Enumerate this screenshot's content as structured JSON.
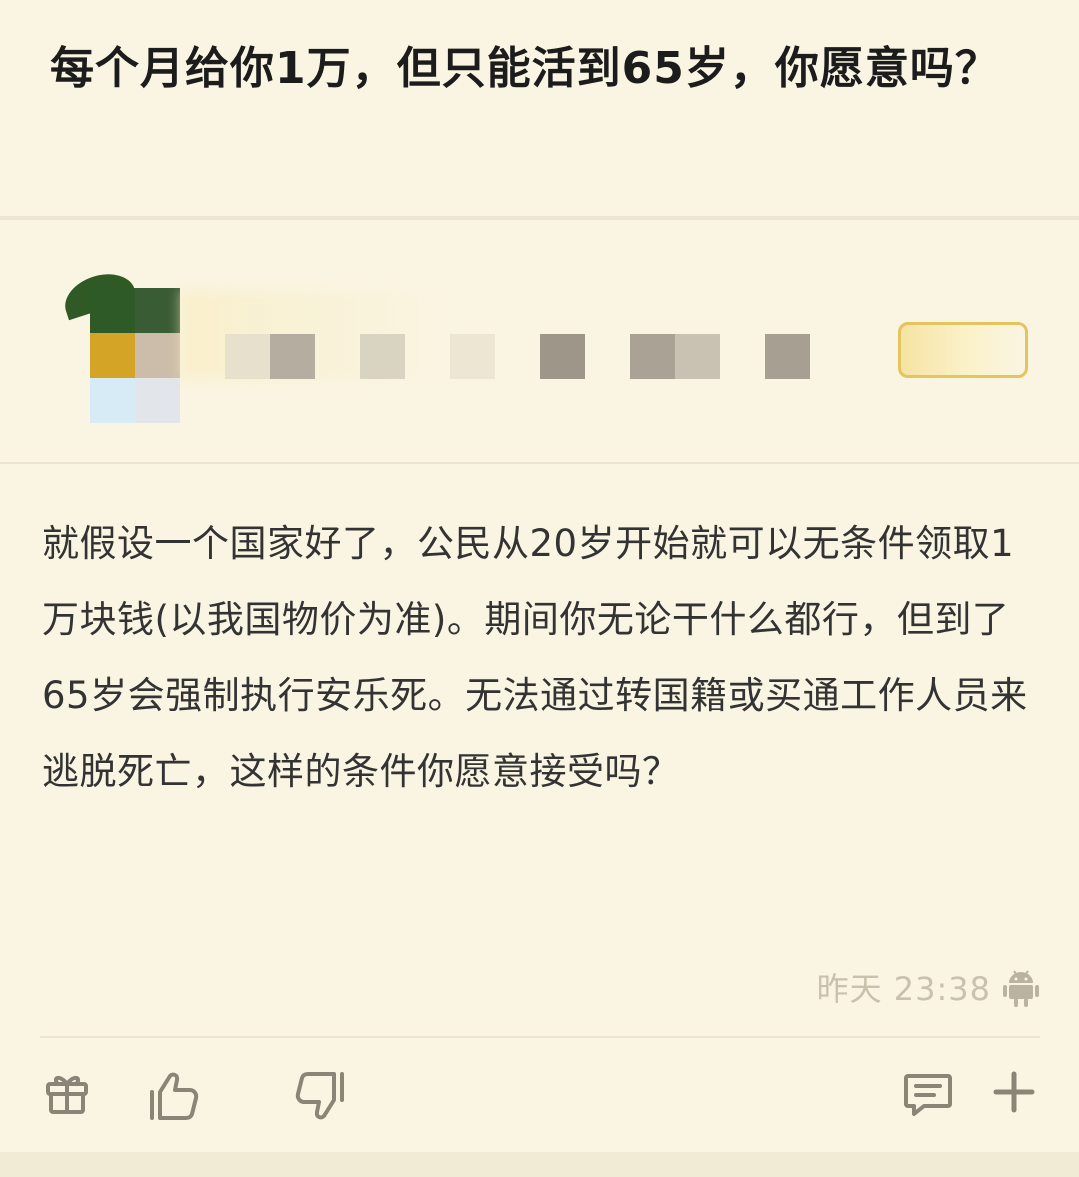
{
  "question": {
    "title": "每个月给你1万，但只能活到65岁，你愿意吗？"
  },
  "author": {
    "avatar_icon": "avatar-pixelated",
    "name_obscured": true,
    "badge_icon": "level-badge"
  },
  "answer": {
    "body": "就假设一个国家好了，公民从20岁开始就可以无条件领取1万块钱(以我国物价为准)。期间你无论干什么都行，但到了65岁会强制执行安乐死。无法通过转国籍或买通工作人员来逃脱死亡，这样的条件你愿意接受吗？",
    "timestamp": "昨天 23:38",
    "device_icon": "android-icon"
  },
  "actions": {
    "gift_icon": "gift-icon",
    "like_icon": "thumbs-up-icon",
    "dislike_icon": "thumbs-down-icon",
    "comment_icon": "comment-icon",
    "add_icon": "plus-icon"
  },
  "colors": {
    "background": "#faf5e3",
    "title": "#1c1c1c",
    "body_text": "#333333",
    "timestamp": "#c8c2ad",
    "icon": "#8a8577",
    "badge_border": "#e4c45e"
  }
}
